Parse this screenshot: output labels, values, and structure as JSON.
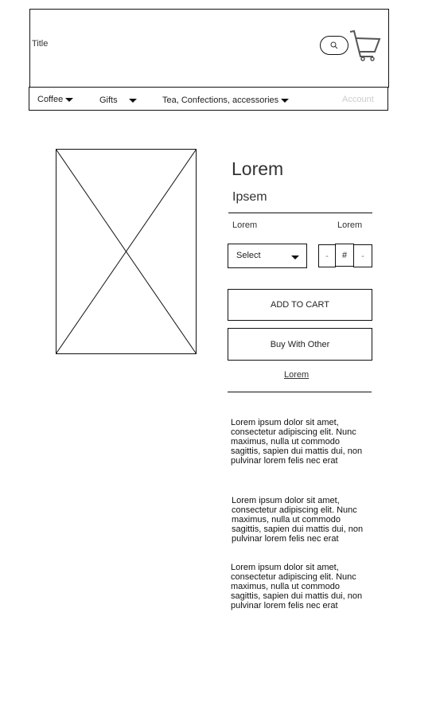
{
  "header": {
    "title": "Title",
    "search_icon": "search-icon",
    "cart_icon": "cart-icon"
  },
  "nav": {
    "items": [
      {
        "label": "Coffee"
      },
      {
        "label": "Gifts"
      },
      {
        "label": "Tea, Confections, accessories"
      }
    ],
    "account": "Account"
  },
  "product": {
    "title": "Lorem",
    "subtitle": "Ipsem",
    "label_left": "Lorem",
    "label_right": "Lorem",
    "select_value": "Select",
    "qty_minus": "-",
    "qty_value": "#",
    "qty_plus": "-",
    "add_to_cart": "ADD TO CART",
    "buy_with_other": "Buy With Other",
    "link": "Lorem"
  },
  "descriptions": [
    "Lorem ipsum dolor sit amet, consectetur adipiscing elit. Nunc maximus, nulla ut commodo sagittis, sapien dui mattis dui, non pulvinar lorem felis nec erat",
    "Lorem ipsum dolor sit amet, consectetur adipiscing elit. Nunc maximus, nulla ut commodo sagittis, sapien dui mattis dui, non pulvinar lorem felis nec erat",
    "Lorem ipsum dolor sit amet, consectetur adipiscing elit. Nunc maximus, nulla ut commodo sagittis, sapien dui mattis dui, non pulvinar lorem felis nec erat"
  ]
}
